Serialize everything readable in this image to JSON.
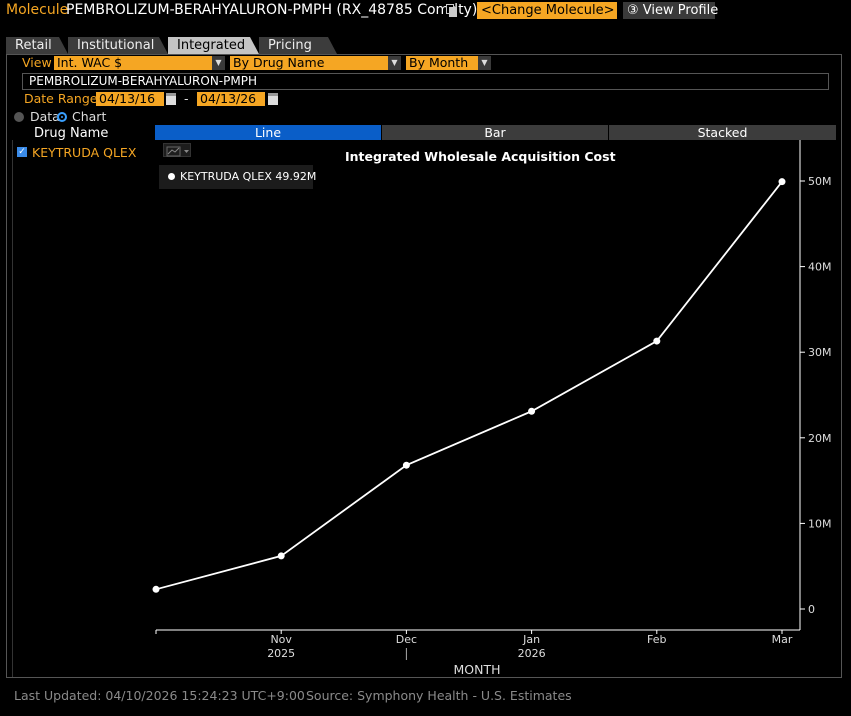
{
  "header": {
    "molecule_label": "Molecule",
    "molecule_title": "PEMBROLIZUM-BERAHYALURON-PMPH (RX_48785 Comdty)",
    "change_molecule": "<Change Molecule>",
    "view_profile": "③ View Profile"
  },
  "tabs": [
    {
      "label": "Retail"
    },
    {
      "label": "Institutional"
    },
    {
      "label": "Integrated",
      "active": true
    },
    {
      "label": "Pricing"
    }
  ],
  "controls": {
    "view_label": "View",
    "view_value": "Int. WAC $",
    "group_value": "By Drug Name",
    "period_value": "By Month",
    "molecule_name": "PEMBROLIZUM-BERAHYALURON-PMPH",
    "date_range_label": "Date Range",
    "date_from": "04/13/16",
    "date_separator": "-",
    "date_to": "04/13/26",
    "mode_data": "Data",
    "mode_chart": "Chart",
    "selected_mode": "Chart"
  },
  "sidebar": {
    "header": "Drug Name",
    "items": [
      {
        "label": "KEYTRUDA QLEX",
        "checked": true
      }
    ]
  },
  "chart_types": [
    "Line",
    "Bar",
    "Stacked"
  ],
  "legend": {
    "label": "KEYTRUDA QLEX 49.92M"
  },
  "chart_data": {
    "type": "line",
    "title": "Integrated Wholesale Acquisition Cost",
    "xlabel": "MONTH",
    "ylabel": "",
    "x": [
      "2025-10",
      "2025-11",
      "2025-12",
      "2026-01",
      "2026-02",
      "2026-03"
    ],
    "x_tick_labels": [
      "Nov",
      "Dec",
      "Jan",
      "Feb",
      "Mar"
    ],
    "x_year_labels": [
      "2025",
      "2026"
    ],
    "series": [
      {
        "name": "KEYTRUDA QLEX",
        "values": [
          2.3,
          6.2,
          16.8,
          23.1,
          31.3,
          49.92
        ],
        "unit": "M"
      }
    ],
    "y_tick_labels": [
      "0",
      "10M",
      "20M",
      "30M",
      "40M",
      "50M"
    ],
    "ylim": [
      0,
      50
    ],
    "line_color": "#ffffff",
    "grid": false,
    "y_axis_side": "right"
  },
  "footer": {
    "last_updated": "Last Updated: 04/10/2026 15:24:23 UTC+9:00",
    "source": "Source: Symphony Health - U.S. Estimates"
  }
}
